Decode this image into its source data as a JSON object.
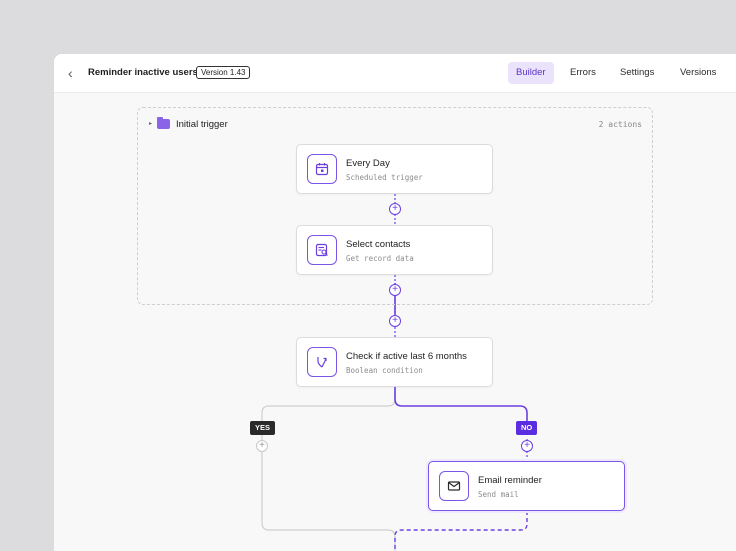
{
  "header": {
    "title": "Reminder inactive users",
    "version": "Version 1.43",
    "tabs": [
      {
        "label": "Builder",
        "active": true
      },
      {
        "label": "Errors",
        "active": false
      },
      {
        "label": "Settings",
        "active": false
      },
      {
        "label": "Versions",
        "active": false
      }
    ]
  },
  "group": {
    "title": "Initial trigger",
    "count": "2 actions"
  },
  "nodes": [
    {
      "title": "Every Day",
      "subtitle": "Scheduled trigger",
      "icon": "calendar-icon"
    },
    {
      "title": "Select contacts",
      "subtitle": "Get record data",
      "icon": "record-search-icon"
    },
    {
      "title": "Check if active last 6 months",
      "subtitle": "Boolean condition",
      "icon": "branch-icon"
    },
    {
      "title": "Email reminder",
      "subtitle": "Send mail",
      "icon": "mail-icon"
    }
  ],
  "branches": {
    "yes": "YES",
    "no": "NO"
  },
  "colors": {
    "accent": "#6a3fe0",
    "accent_light": "#ebe3fc",
    "yes_pill": "#2a2a2a",
    "no_pill": "#5a2ee0"
  }
}
